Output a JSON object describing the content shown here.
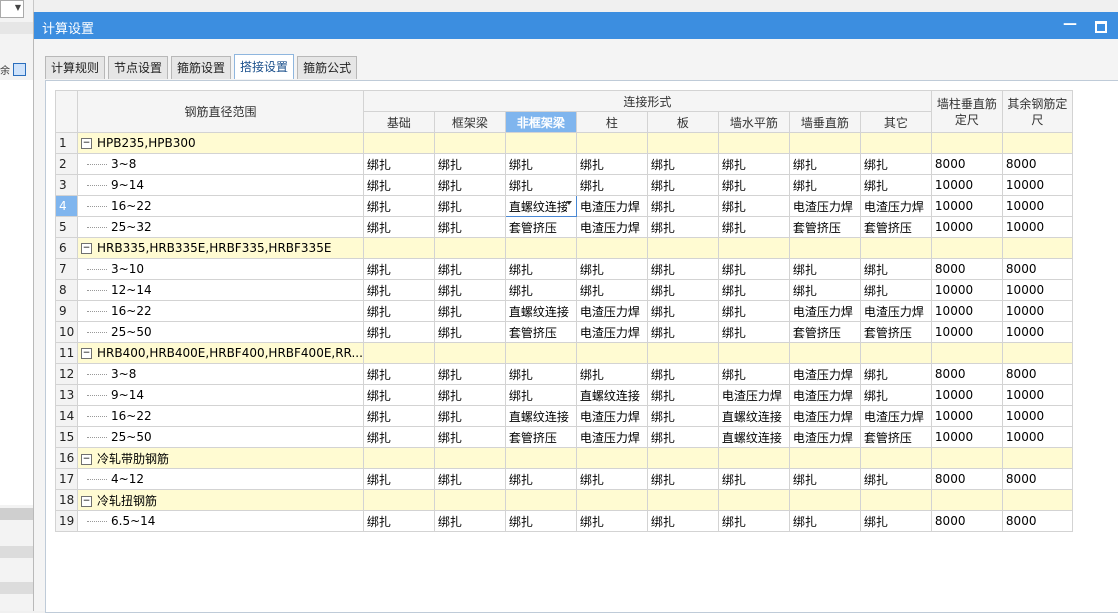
{
  "window": {
    "title": "计算设置"
  },
  "tabs": [
    {
      "label": "计算规则",
      "active": false
    },
    {
      "label": "节点设置",
      "active": false
    },
    {
      "label": "箍筋设置",
      "active": false
    },
    {
      "label": "搭接设置",
      "active": true
    },
    {
      "label": "箍筋公式",
      "active": false
    }
  ],
  "grid": {
    "header": {
      "diameter_range": "钢筋直径范围",
      "connection_form": "连接形式",
      "sub_columns": [
        "基础",
        "框架梁",
        "非框架梁",
        "柱",
        "板",
        "墙水平筋",
        "墙垂直筋",
        "其它"
      ],
      "selected_column": 2,
      "wall_column_length": "墙柱垂直筋定尺",
      "other_length": "其余钢筋定尺"
    },
    "selected_row": 4,
    "editing_cell": {
      "row": 4,
      "col": 2
    },
    "rows": [
      {
        "num": "1",
        "type": "group",
        "name": "HPB235,HPB300"
      },
      {
        "num": "2",
        "type": "item",
        "name": "3~8",
        "cells": [
          "绑扎",
          "绑扎",
          "绑扎",
          "绑扎",
          "绑扎",
          "绑扎",
          "绑扎",
          "绑扎",
          "8000",
          "8000"
        ]
      },
      {
        "num": "3",
        "type": "item",
        "name": "9~14",
        "cells": [
          "绑扎",
          "绑扎",
          "绑扎",
          "绑扎",
          "绑扎",
          "绑扎",
          "绑扎",
          "绑扎",
          "10000",
          "10000"
        ]
      },
      {
        "num": "4",
        "type": "item",
        "name": "16~22",
        "cells": [
          "绑扎",
          "绑扎",
          "直螺纹连接",
          "电渣压力焊",
          "绑扎",
          "绑扎",
          "电渣压力焊",
          "电渣压力焊",
          "10000",
          "10000"
        ]
      },
      {
        "num": "5",
        "type": "item",
        "name": "25~32",
        "cells": [
          "绑扎",
          "绑扎",
          "套管挤压",
          "电渣压力焊",
          "绑扎",
          "绑扎",
          "套管挤压",
          "套管挤压",
          "10000",
          "10000"
        ]
      },
      {
        "num": "6",
        "type": "group",
        "name": "HRB335,HRB335E,HRBF335,HRBF335E"
      },
      {
        "num": "7",
        "type": "item",
        "name": "3~10",
        "cells": [
          "绑扎",
          "绑扎",
          "绑扎",
          "绑扎",
          "绑扎",
          "绑扎",
          "绑扎",
          "绑扎",
          "8000",
          "8000"
        ]
      },
      {
        "num": "8",
        "type": "item",
        "name": "12~14",
        "cells": [
          "绑扎",
          "绑扎",
          "绑扎",
          "绑扎",
          "绑扎",
          "绑扎",
          "绑扎",
          "绑扎",
          "10000",
          "10000"
        ]
      },
      {
        "num": "9",
        "type": "item",
        "name": "16~22",
        "cells": [
          "绑扎",
          "绑扎",
          "直螺纹连接",
          "电渣压力焊",
          "绑扎",
          "绑扎",
          "电渣压力焊",
          "电渣压力焊",
          "10000",
          "10000"
        ]
      },
      {
        "num": "10",
        "type": "item",
        "name": "25~50",
        "cells": [
          "绑扎",
          "绑扎",
          "套管挤压",
          "电渣压力焊",
          "绑扎",
          "绑扎",
          "套管挤压",
          "套管挤压",
          "10000",
          "10000"
        ]
      },
      {
        "num": "11",
        "type": "group",
        "name": "HRB400,HRB400E,HRBF400,HRBF400E,RR..."
      },
      {
        "num": "12",
        "type": "item",
        "name": "3~8",
        "cells": [
          "绑扎",
          "绑扎",
          "绑扎",
          "绑扎",
          "绑扎",
          "绑扎",
          "电渣压力焊",
          "绑扎",
          "8000",
          "8000"
        ]
      },
      {
        "num": "13",
        "type": "item",
        "name": "9~14",
        "cells": [
          "绑扎",
          "绑扎",
          "绑扎",
          "直螺纹连接",
          "绑扎",
          "电渣压力焊",
          "电渣压力焊",
          "绑扎",
          "10000",
          "10000"
        ]
      },
      {
        "num": "14",
        "type": "item",
        "name": "16~22",
        "cells": [
          "绑扎",
          "绑扎",
          "直螺纹连接",
          "电渣压力焊",
          "绑扎",
          "直螺纹连接",
          "电渣压力焊",
          "电渣压力焊",
          "10000",
          "10000"
        ]
      },
      {
        "num": "15",
        "type": "item",
        "name": "25~50",
        "cells": [
          "绑扎",
          "绑扎",
          "套管挤压",
          "电渣压力焊",
          "绑扎",
          "直螺纹连接",
          "电渣压力焊",
          "套管挤压",
          "10000",
          "10000"
        ]
      },
      {
        "num": "16",
        "type": "group",
        "name": "冷轧带肋钢筋"
      },
      {
        "num": "17",
        "type": "item",
        "name": "4~12",
        "cells": [
          "绑扎",
          "绑扎",
          "绑扎",
          "绑扎",
          "绑扎",
          "绑扎",
          "绑扎",
          "绑扎",
          "8000",
          "8000"
        ]
      },
      {
        "num": "18",
        "type": "group",
        "name": "冷轧扭钢筋"
      },
      {
        "num": "19",
        "type": "item",
        "name": "6.5~14",
        "cells": [
          "绑扎",
          "绑扎",
          "绑扎",
          "绑扎",
          "绑扎",
          "绑扎",
          "绑扎",
          "绑扎",
          "8000",
          "8000"
        ]
      }
    ]
  },
  "colors": {
    "title_bar": "#3c8ee0",
    "header_accent": "#7fb5ee",
    "group_row": "#fffbd2"
  },
  "icons": {
    "collapse": "collapse-minus-icon",
    "minimize": "minimize-icon",
    "maximize": "maximize-icon"
  }
}
